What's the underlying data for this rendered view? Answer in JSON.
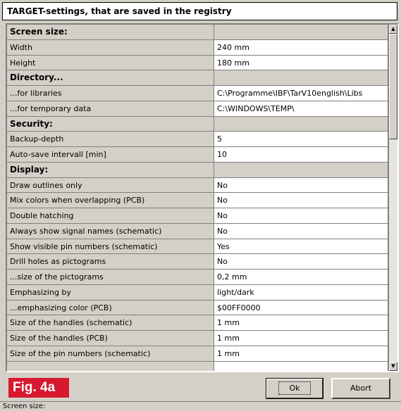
{
  "window": {
    "title": "TARGET-settings, that are saved in the registry"
  },
  "rows": [
    {
      "label": "Screen size:",
      "value": "",
      "header": true
    },
    {
      "label": "Width",
      "value": "240 mm"
    },
    {
      "label": "Height",
      "value": "180 mm"
    },
    {
      "label": "Directory...",
      "value": "",
      "header": true
    },
    {
      "label": "...for libraries",
      "value": "C:\\Programme\\IBF\\TarV10english\\Libs"
    },
    {
      "label": "...for temporary data",
      "value": "C:\\WINDOWS\\TEMP\\"
    },
    {
      "label": "Security:",
      "value": "",
      "header": true
    },
    {
      "label": "Backup-depth",
      "value": "5"
    },
    {
      "label": "Auto-save intervall [min]",
      "value": "10"
    },
    {
      "label": "Display:",
      "value": "",
      "header": true
    },
    {
      "label": "Draw outlines only",
      "value": "No"
    },
    {
      "label": "Mix colors when overlapping (PCB)",
      "value": "No"
    },
    {
      "label": "Double hatching",
      "value": "No"
    },
    {
      "label": "Always show signal names (schematic)",
      "value": "No"
    },
    {
      "label": "Show visible pin numbers (schematic)",
      "value": "Yes"
    },
    {
      "label": "Drill holes as pictograms",
      "value": "No"
    },
    {
      "label": "...size of the pictograms",
      "value": "0,2 mm"
    },
    {
      "label": "Emphasizing by",
      "value": "light/dark"
    },
    {
      "label": "...emphasizing color (PCB)",
      "value": "$00FF0000"
    },
    {
      "label": "Size of the handles (schematic)",
      "value": "1 mm"
    },
    {
      "label": "Size of the handles (PCB)",
      "value": "1 mm"
    },
    {
      "label": "Size of the pin numbers (schematic)",
      "value": "1 mm"
    },
    {
      "label": "",
      "value": "",
      "partial": true
    }
  ],
  "scrollbar": {
    "up_icon": "arrow-up-icon",
    "down_icon": "arrow-down-icon"
  },
  "figure_label": "Fig. 4a",
  "buttons": {
    "ok": "Ok",
    "abort": "Abort"
  },
  "status": {
    "text": "Screen size:"
  },
  "colors": {
    "figure_label_bg": "#d7192f",
    "dialog_bg": "#d4d0c8"
  }
}
